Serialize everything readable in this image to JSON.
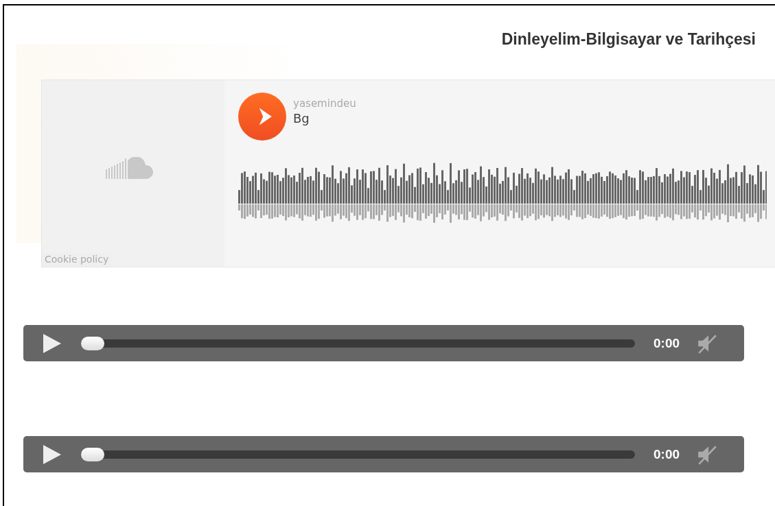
{
  "page_title": "Dinleyelim-Bilgisayar ve Tarihçesi",
  "embed": {
    "username": "yasemindeu",
    "track_title": "Bg",
    "cookie_link": "Cookie policy"
  },
  "players": [
    {
      "time": "0:00",
      "level": 0,
      "muted": true
    },
    {
      "time": "0:00",
      "level": 0,
      "muted": true
    }
  ]
}
